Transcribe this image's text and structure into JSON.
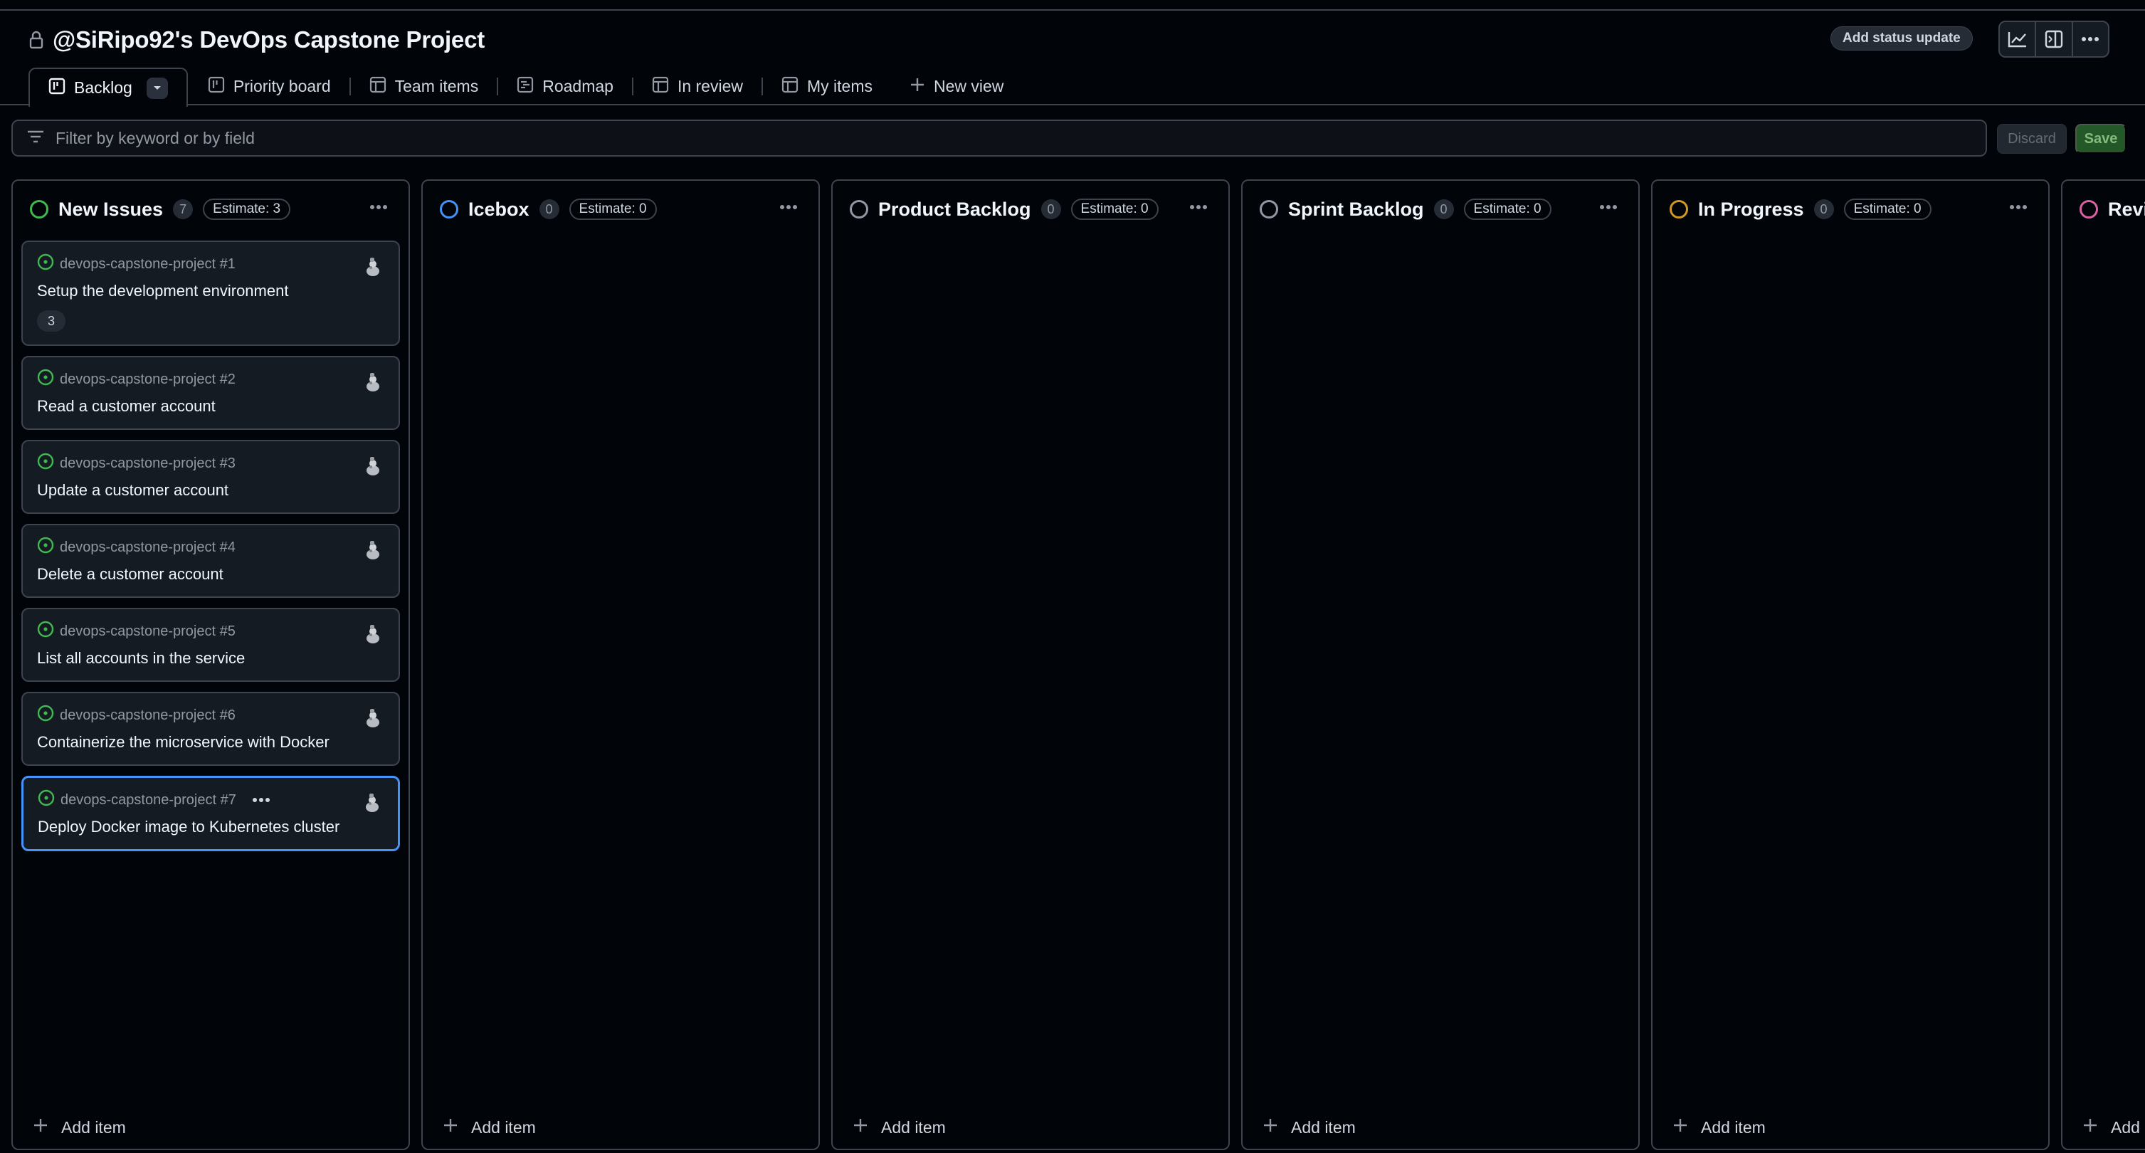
{
  "project": {
    "title": "@SiRipo92's DevOps Capstone Project",
    "status_update_label": "Add status update"
  },
  "header_icons": [
    "insights-icon",
    "sidepanel-icon",
    "more-icon"
  ],
  "tabs": [
    {
      "label": "Backlog",
      "icon": "board-icon",
      "active": true
    },
    {
      "label": "Priority board",
      "icon": "board-icon"
    },
    {
      "label": "Team items",
      "icon": "table-icon"
    },
    {
      "label": "Roadmap",
      "icon": "roadmap-icon"
    },
    {
      "label": "In review",
      "icon": "table-icon"
    },
    {
      "label": "My items",
      "icon": "table-icon"
    },
    {
      "label": "New view",
      "icon": "plus-icon"
    }
  ],
  "filter": {
    "placeholder": "Filter by keyword or by field",
    "discard_label": "Discard",
    "save_label": "Save"
  },
  "columns": [
    {
      "name": "New Issues",
      "count": "7",
      "estimate": "Estimate: 3",
      "color": "#3fb950",
      "add_label": "Add item",
      "cards": [
        {
          "repo": "devops-capstone-project #1",
          "title": "Setup the development environment",
          "estimate": "3"
        },
        {
          "repo": "devops-capstone-project #2",
          "title": "Read a customer account"
        },
        {
          "repo": "devops-capstone-project #3",
          "title": "Update a customer account"
        },
        {
          "repo": "devops-capstone-project #4",
          "title": "Delete a customer account"
        },
        {
          "repo": "devops-capstone-project #5",
          "title": "List all accounts in the service"
        },
        {
          "repo": "devops-capstone-project #6",
          "title": "Containerize the microservice with Docker"
        },
        {
          "repo": "devops-capstone-project #7",
          "title": "Deploy Docker image to Kubernetes cluster",
          "selected": true
        }
      ]
    },
    {
      "name": "Icebox",
      "count": "0",
      "estimate": "Estimate: 0",
      "color": "#4493f8",
      "add_label": "Add item",
      "cards": []
    },
    {
      "name": "Product Backlog",
      "count": "0",
      "estimate": "Estimate: 0",
      "color": "#9198a1",
      "add_label": "Add item",
      "cards": []
    },
    {
      "name": "Sprint Backlog",
      "count": "0",
      "estimate": "Estimate: 0",
      "color": "#9198a1",
      "add_label": "Add item",
      "cards": []
    },
    {
      "name": "In Progress",
      "count": "0",
      "estimate": "Estimate: 0",
      "color": "#d29922",
      "add_label": "Add item",
      "cards": []
    },
    {
      "name": "Revie",
      "count": "",
      "estimate": "",
      "color": "#db61a2",
      "add_label": "Add ite",
      "cards": []
    }
  ]
}
